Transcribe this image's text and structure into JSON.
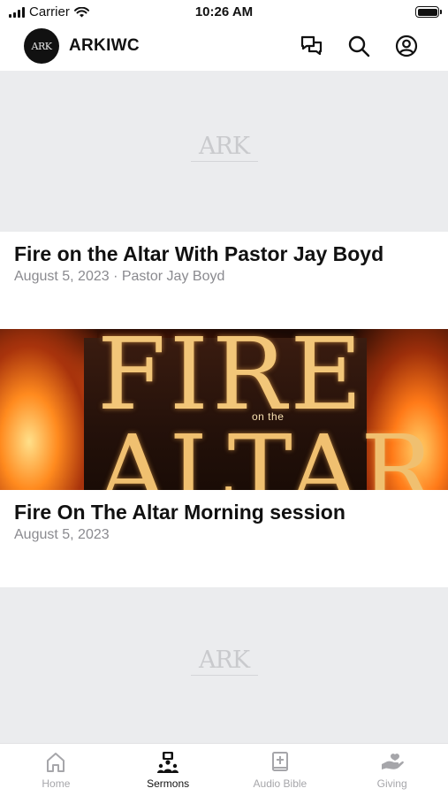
{
  "status_bar": {
    "carrier": "Carrier",
    "time": "10:26 AM"
  },
  "header": {
    "logo_text": "ARK",
    "title": "ARKIWC"
  },
  "sermons": [
    {
      "title": "Fire on the Altar With Pastor Jay Boyd",
      "meta": "August 5, 2023 · Pastor Jay Boyd",
      "thumbnail": "ark-placeholder",
      "watermark": "ARK"
    },
    {
      "title": "Fire On The Altar Morning session",
      "meta": "August 5, 2023",
      "thumbnail": "fire-on-the-altar",
      "art_text": {
        "word1": "FIRE",
        "small": "on the",
        "word2": "ALTAR"
      }
    },
    {
      "thumbnail": "ark-placeholder",
      "watermark": "ARK"
    }
  ],
  "tabs": [
    {
      "label": "Home",
      "icon": "home-icon",
      "active": false
    },
    {
      "label": "Sermons",
      "icon": "sermons-icon",
      "active": true
    },
    {
      "label": "Audio Bible",
      "icon": "bible-icon",
      "active": false
    },
    {
      "label": "Giving",
      "icon": "giving-icon",
      "active": false
    }
  ],
  "colors": {
    "active_tab": "#111111",
    "inactive_tab": "#a6a6aa",
    "meta_text": "#8a8a8f",
    "placeholder_bg": "#ebecee"
  }
}
